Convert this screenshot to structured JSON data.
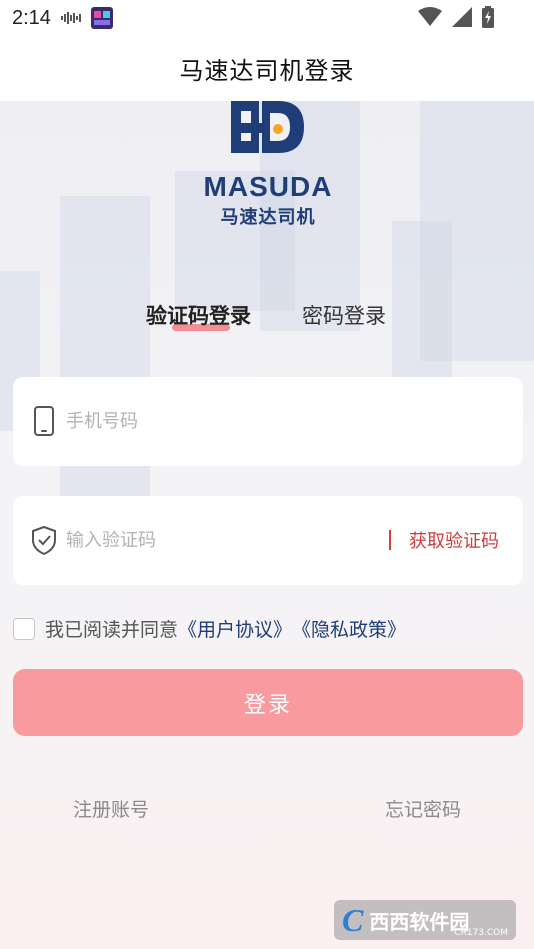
{
  "status_bar": {
    "time": "2:14"
  },
  "title_bar": {
    "title": "马速达司机登录"
  },
  "logo": {
    "brand": "MASUDA",
    "brand_cn": "马速达司机",
    "primary_color": "#1f3e78",
    "accent_color": "#f5a623"
  },
  "tabs": {
    "active": "验证码登录",
    "inactive": "密码登录"
  },
  "form": {
    "phone_placeholder": "手机号码",
    "code_placeholder": "输入验证码",
    "get_code_label": "获取验证码"
  },
  "agreement": {
    "prefix": "我已阅读并同意",
    "user_agreement": "《用户协议》",
    "privacy_policy": "《隐私政策》",
    "checked": false
  },
  "login_button": {
    "label": "登录",
    "color": "#f99a9f"
  },
  "bottom_links": {
    "register": "注册账号",
    "forgot": "忘记密码"
  },
  "watermark": {
    "text": "西西软件园",
    "url": "CR173.COM"
  }
}
